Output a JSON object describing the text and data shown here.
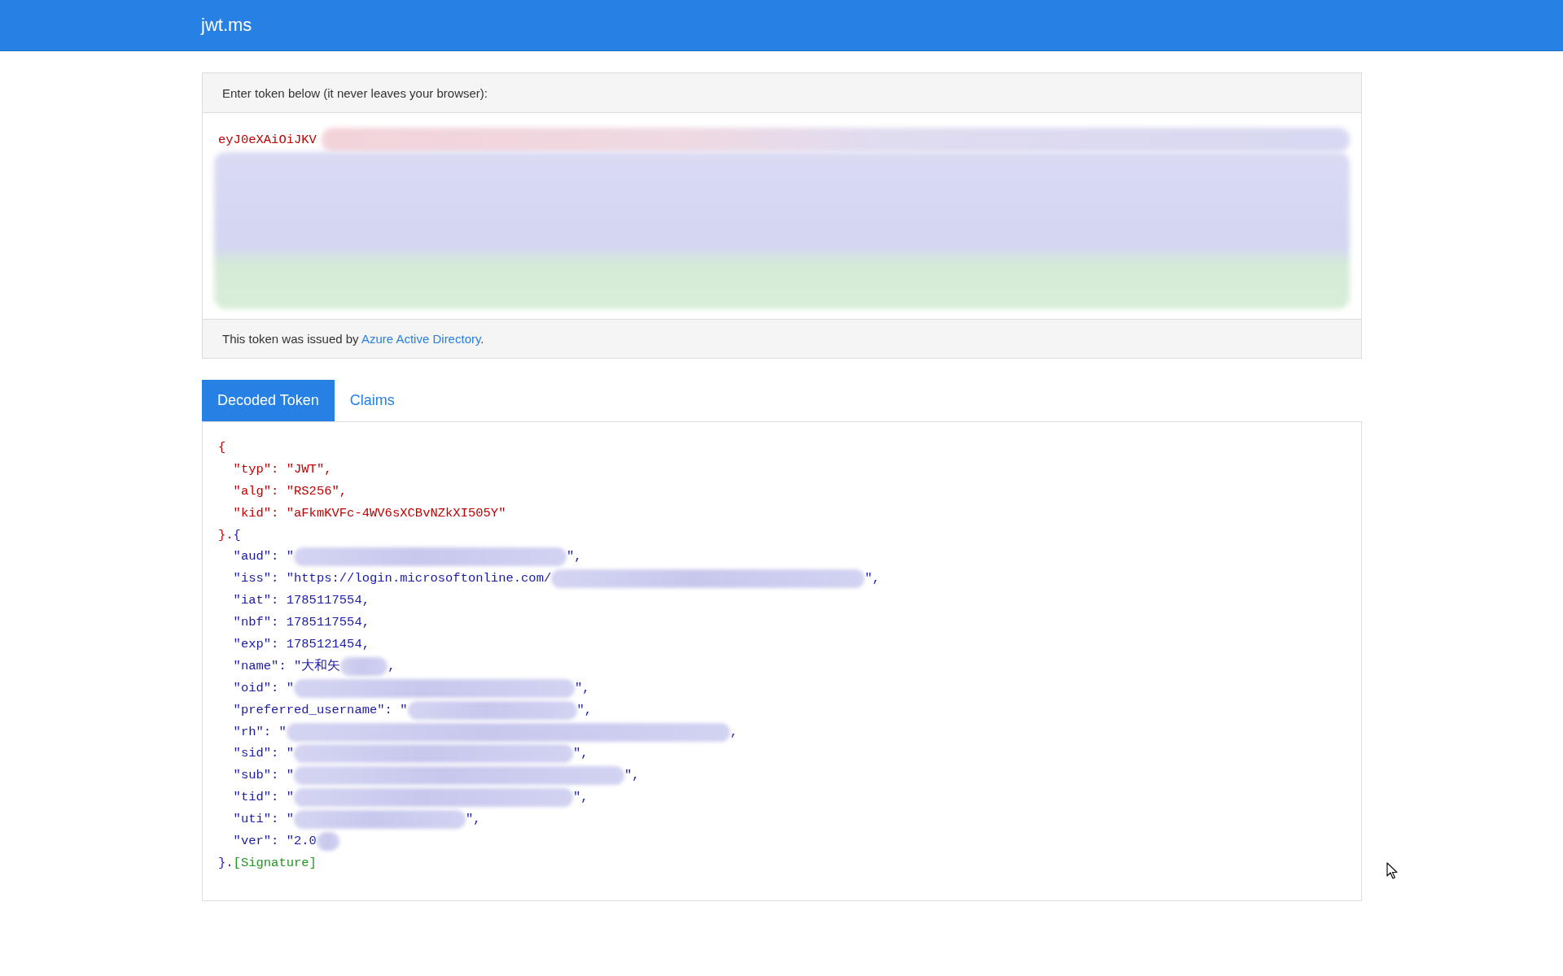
{
  "header": {
    "title": "jwt.ms"
  },
  "token_panel": {
    "heading": "Enter token below (it never leaves your browser):",
    "token_text": "eyJ0eXAiOiJKV",
    "redacted": true,
    "issuer_note": {
      "text": "This token was issued by",
      "link": "Azure Active Directory",
      "end": "."
    }
  },
  "tabs": [
    {
      "label": "Decoded Token",
      "selected": true
    },
    {
      "label": "Claims",
      "selected": false
    }
  ],
  "decoded_token": {
    "header": {
      "open": "{",
      "entries": [
        "\"typ\": \"JWT\",",
        "\"alg\": \"RS256\",",
        "\"kid\": \"aFkmKVFc-4WV6sXCBvNZkXI505Y\""
      ],
      "close": "}."
    },
    "payload": {
      "open": "{",
      "entries": [
        {
          "text": "\"aud\": \"",
          "redacted": true,
          "suffix": "\","
        },
        {
          "text": "\"iss\": \"https://login.microsoftonline.com/",
          "redacted": true,
          "suffix": "\","
        },
        {
          "text": "\"iat\": 1785117554,",
          "redacted": false
        },
        {
          "text": "\"nbf\": 1785117554,",
          "redacted": false
        },
        {
          "text": "\"exp\": 1785121454,",
          "redacted": false
        },
        {
          "text": "\"name\": \"大和矢",
          "redacted": true,
          "suffix": ","
        },
        {
          "text": "\"oid\": \"",
          "redacted": true,
          "suffix": "\","
        },
        {
          "text": "\"preferred_username\": \"",
          "redacted": true,
          "suffix": "\","
        },
        {
          "text": "\"rh\": \"",
          "redacted": true,
          "suffix": ","
        },
        {
          "text": "\"sid\": \"",
          "redacted": true,
          "suffix": "\","
        },
        {
          "text": "\"sub\": \"",
          "redacted": true,
          "suffix": "\","
        },
        {
          "text": "\"tid\": \"",
          "redacted": true,
          "suffix": "\","
        },
        {
          "text": "\"uti\": \"",
          "redacted": true,
          "suffix": "\","
        },
        {
          "text": "\"ver\": \"2.0",
          "redacted": true
        }
      ],
      "close": "}."
    },
    "signature": "[Signature]"
  }
}
